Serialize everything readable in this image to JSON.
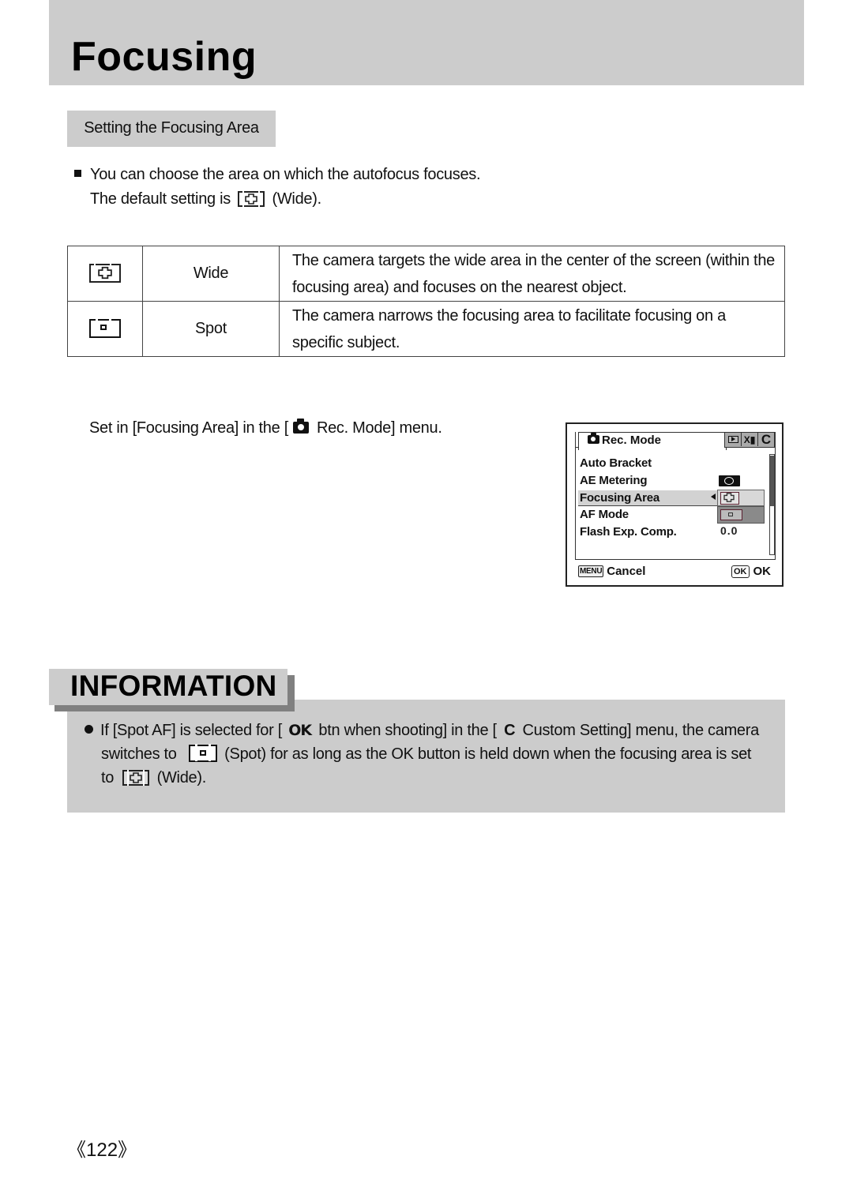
{
  "header": {
    "title": "Focusing"
  },
  "section": {
    "tab_label": "Setting the Focusing Area"
  },
  "intro": {
    "line1": "You can choose the area on which the autofocus focuses.",
    "line2_prefix": "The default setting is",
    "line2_suffix": "(Wide).",
    "default_icon": "af-wide-icon"
  },
  "modes_table": {
    "rows": [
      {
        "icon": "af-wide-icon",
        "name": "Wide",
        "description": "The camera targets the wide area in the center of the screen (within the focusing area) and focuses on the nearest object."
      },
      {
        "icon": "af-spot-icon",
        "name": "Spot",
        "description": "The camera narrows the focusing area to facilitate focusing on a specific subject."
      }
    ]
  },
  "set_in": {
    "prefix": "Set in [Focusing Area] in the [",
    "suffix": "Rec. Mode] menu.",
    "icon": "camera-icon"
  },
  "camera_menu": {
    "tab_title": "Rec. Mode",
    "tabs_right": [
      "playback-icon",
      "setup-icon",
      "C"
    ],
    "items": [
      {
        "label": "Auto Bracket",
        "value": ""
      },
      {
        "label": "AE Metering",
        "value": "metering-icon"
      },
      {
        "label": "Focusing Area",
        "value": "af-wide-icon",
        "selected": true
      },
      {
        "label": "AF Mode",
        "value": ""
      },
      {
        "label": "Flash Exp. Comp.",
        "value": "0.0"
      }
    ],
    "dropdown_options": [
      "Wide",
      "Spot"
    ],
    "dropdown_selected": "Wide",
    "footer": {
      "cancel_key": "MENU",
      "cancel_label": "Cancel",
      "ok_key": "OK",
      "ok_label": "OK"
    }
  },
  "information": {
    "label": "INFORMATION",
    "p1": "If [Spot AF] is selected for [",
    "ok_glyph": "OK",
    "p2": "btn when shooting] in the [",
    "c_glyph": "C",
    "p3": "Custom Setting] menu, the camera",
    "p4": "switches to",
    "p5": "(Spot) for as long as the OK button is held down when the focusing area is set",
    "p6": "to",
    "p7": "(Wide)."
  },
  "footer": {
    "page_number": "《122》"
  }
}
